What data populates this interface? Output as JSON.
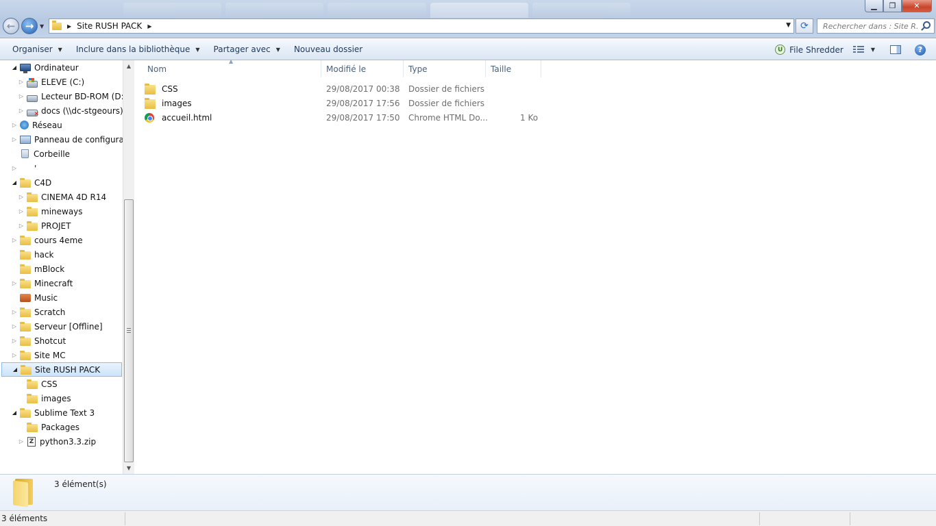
{
  "window": {
    "controls": {
      "minimize": "▁",
      "maximize": "❐",
      "close": "✕"
    }
  },
  "address": {
    "path": [
      "Site RUSH PACK"
    ],
    "search_placeholder": "Rechercher dans : Site R..."
  },
  "toolbar": {
    "items": [
      "Organiser",
      "Inclure dans la bibliothèque",
      "Partager avec",
      "Nouveau dossier"
    ],
    "has_caret": [
      true,
      true,
      true,
      false
    ],
    "file_shredder": "File Shredder"
  },
  "tree": [
    {
      "label": "Ordinateur",
      "icon": "computer-icon",
      "indent": 0,
      "expander": "open"
    },
    {
      "label": "ELEVE (C:)",
      "icon": "system-drive-icon",
      "indent": 1,
      "expander": "closed"
    },
    {
      "label": "Lecteur BD-ROM (D:)",
      "icon": "optical-drive-icon",
      "indent": 1,
      "expander": "closed"
    },
    {
      "label": "docs (\\\\dc-stgeours) (",
      "icon": "disconnected-network-drive-icon",
      "indent": 1,
      "expander": "closed"
    },
    {
      "label": "Réseau",
      "icon": "network-icon",
      "indent": 0,
      "expander": "closed"
    },
    {
      "label": "Panneau de configuratio",
      "icon": "control-panel-icon",
      "indent": 0,
      "expander": "closed"
    },
    {
      "label": "Corbeille",
      "icon": "recycle-bin-icon",
      "indent": 0,
      "expander": "none"
    },
    {
      "label": "'",
      "icon": "none",
      "indent": 0,
      "expander": "closed"
    },
    {
      "label": "C4D",
      "icon": "folder-icon",
      "indent": 0,
      "expander": "open"
    },
    {
      "label": "CINEMA 4D R14",
      "icon": "folder-icon",
      "indent": 1,
      "expander": "closed"
    },
    {
      "label": "mineways",
      "icon": "folder-icon",
      "indent": 1,
      "expander": "closed"
    },
    {
      "label": "PROJET",
      "icon": "folder-icon",
      "indent": 1,
      "expander": "closed"
    },
    {
      "label": "cours 4eme",
      "icon": "folder-icon",
      "indent": 0,
      "expander": "closed"
    },
    {
      "label": "hack",
      "icon": "folder-icon",
      "indent": 0,
      "expander": "none"
    },
    {
      "label": "mBlock",
      "icon": "folder-icon",
      "indent": 0,
      "expander": "none"
    },
    {
      "label": "Minecraft",
      "icon": "folder-icon",
      "indent": 0,
      "expander": "closed"
    },
    {
      "label": "Music",
      "icon": "music-library-icon",
      "indent": 0,
      "expander": "none"
    },
    {
      "label": "Scratch",
      "icon": "folder-icon",
      "indent": 0,
      "expander": "closed"
    },
    {
      "label": "Serveur [Offline]",
      "icon": "folder-icon",
      "indent": 0,
      "expander": "closed"
    },
    {
      "label": "Shotcut",
      "icon": "folder-icon",
      "indent": 0,
      "expander": "closed"
    },
    {
      "label": "Site MC",
      "icon": "folder-icon",
      "indent": 0,
      "expander": "closed"
    },
    {
      "label": "Site RUSH PACK",
      "icon": "folder-icon",
      "indent": 0,
      "expander": "open",
      "selected": true
    },
    {
      "label": "CSS",
      "icon": "folder-icon",
      "indent": 1,
      "expander": "none"
    },
    {
      "label": "images",
      "icon": "folder-icon",
      "indent": 1,
      "expander": "none"
    },
    {
      "label": "Sublime Text 3",
      "icon": "folder-icon",
      "indent": 0,
      "expander": "open"
    },
    {
      "label": "Packages",
      "icon": "folder-icon",
      "indent": 1,
      "expander": "none"
    },
    {
      "label": "python3.3.zip",
      "icon": "zip-icon",
      "indent": 1,
      "expander": "closed"
    }
  ],
  "columns": [
    "Nom",
    "Modifié le",
    "Type",
    "Taille"
  ],
  "files": [
    {
      "name": "CSS",
      "modified": "29/08/2017 00:38",
      "type": "Dossier de fichiers",
      "size": "",
      "icon": "folder-icon"
    },
    {
      "name": "images",
      "modified": "29/08/2017 17:56",
      "type": "Dossier de fichiers",
      "size": "",
      "icon": "folder-icon"
    },
    {
      "name": "accueil.html",
      "modified": "29/08/2017 17:50",
      "type": "Chrome HTML Do...",
      "size": "1 Ko",
      "icon": "chrome-icon"
    }
  ],
  "details": {
    "count": "3 élément(s)"
  },
  "status": {
    "text": "3 éléments"
  }
}
